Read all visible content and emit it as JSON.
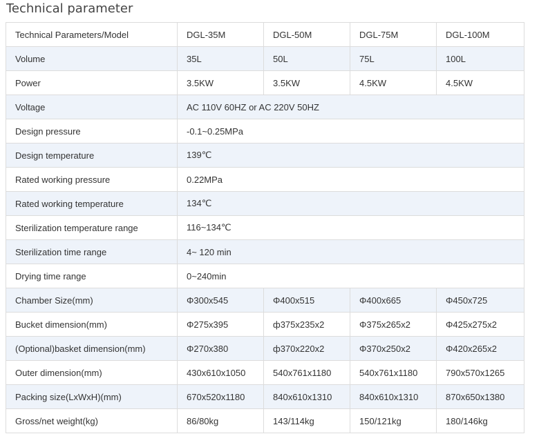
{
  "page": {
    "title": "Technical parameter"
  },
  "table": {
    "header": [
      "Technical Parameters/Model",
      "DGL-35M",
      "DGL-50M",
      "DGL-75M",
      "DGL-100M"
    ],
    "rows": [
      {
        "label": "Volume",
        "cells": [
          "35L",
          "50L",
          "75L",
          "100L"
        ]
      },
      {
        "label": "Power",
        "cells": [
          "3.5KW",
          "3.5KW",
          "4.5KW",
          "4.5KW"
        ]
      },
      {
        "label": "Voltage",
        "cells": [
          "AC 110V 60HZ or AC 220V 50HZ"
        ]
      },
      {
        "label": "Design pressure",
        "cells": [
          "-0.1~0.25MPa"
        ]
      },
      {
        "label": "Design temperature",
        "cells": [
          "139℃"
        ]
      },
      {
        "label": "Rated working pressure",
        "cells": [
          "0.22MPa"
        ]
      },
      {
        "label": "Rated working temperature",
        "cells": [
          "134℃"
        ]
      },
      {
        "label": "Sterilization temperature range",
        "cells": [
          "116~134℃"
        ]
      },
      {
        "label": "Sterilization time range",
        "cells": [
          "4~ 120 min"
        ]
      },
      {
        "label": "Drying time range",
        "cells": [
          "0~240min"
        ]
      },
      {
        "label": "Chamber Size(mm)",
        "cells": [
          "Φ300x545",
          "Φ400x515",
          "Φ400x665",
          "Φ450x725"
        ]
      },
      {
        "label": "Bucket dimension(mm)",
        "cells": [
          "Φ275x395",
          "ф375x235x2",
          "Φ375x265x2",
          "Φ425x275x2"
        ]
      },
      {
        "label": "(Optional)basket dimension(mm)",
        "cells": [
          "Φ270x380",
          "ф370x220x2",
          "Φ370x250x2",
          "Φ420x265x2"
        ]
      },
      {
        "label": "Outer dimension(mm)",
        "cells": [
          "430x610x1050",
          "540x761x1180",
          "540x761x1180",
          "790x570x1265"
        ]
      },
      {
        "label": "Packing size(LxWxH)(mm)",
        "cells": [
          "670x520x1180",
          "840x610x1310",
          "840x610x1310",
          "870x650x1380"
        ]
      },
      {
        "label": "Gross/net weight(kg)",
        "cells": [
          "86/80kg",
          "143/114kg",
          "150/121kg",
          "180/146kg"
        ]
      }
    ]
  },
  "colors": {
    "shaded_row": "#eef3fa",
    "border": "#dcdcdc",
    "text": "#333333"
  }
}
